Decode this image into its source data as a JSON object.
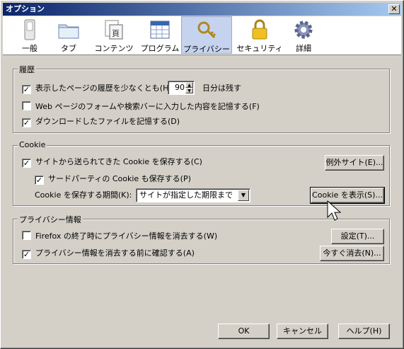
{
  "window": {
    "title": "オプション",
    "close_glyph": "✕"
  },
  "toolbar": [
    {
      "label": "一般",
      "icon": "switch-icon"
    },
    {
      "label": "タブ",
      "icon": "folder-tab-icon"
    },
    {
      "label": "コンテンツ",
      "icon": "content-page-icon"
    },
    {
      "label": "プログラム",
      "icon": "calendar-app-icon"
    },
    {
      "label": "プライバシー",
      "icon": "key-icon",
      "selected": true
    },
    {
      "label": "セキュリティ",
      "icon": "lock-icon"
    },
    {
      "label": "詳細",
      "icon": "gear-icon"
    }
  ],
  "history": {
    "title": "履歴",
    "keep_prefix": "表示したページの履歴を少なくとも(H)",
    "keep_days": "90",
    "keep_suffix": "日分は残す",
    "form_label": "Web ページのフォームや検索バーに入力した内容を記憶する(F)",
    "download_label": "ダウンロードしたファイルを記憶する(D)",
    "keep_checked": true,
    "form_checked": false,
    "download_checked": true
  },
  "cookie": {
    "title": "Cookie",
    "accept_label": "サイトから送られてきた Cookie を保存する(C)",
    "third_party_label": "サードパーティの Cookie も保存する(P)",
    "keep_until_label": "Cookie を保存する期間(K):",
    "keep_until_value": "サイトが指定した期限まで",
    "exceptions_button": "例外サイト(E)...",
    "show_cookies_button": "Cookie を表示(S)...",
    "accept_checked": true,
    "third_party_checked": true
  },
  "private_data": {
    "title": "プライバシー情報",
    "clear_on_exit_label": "Firefox の終了時にプライバシー情報を消去する(W)",
    "ask_before_label": "プライバシー情報を消去する前に確認する(A)",
    "settings_button": "設定(T)...",
    "clear_now_button": "今すぐ消去(N)...",
    "clear_on_exit_checked": false,
    "ask_before_checked": true
  },
  "dialog_buttons": {
    "ok": "OK",
    "cancel": "キャンセル",
    "help": "ヘルプ(H)"
  },
  "check_glyph": "✓"
}
